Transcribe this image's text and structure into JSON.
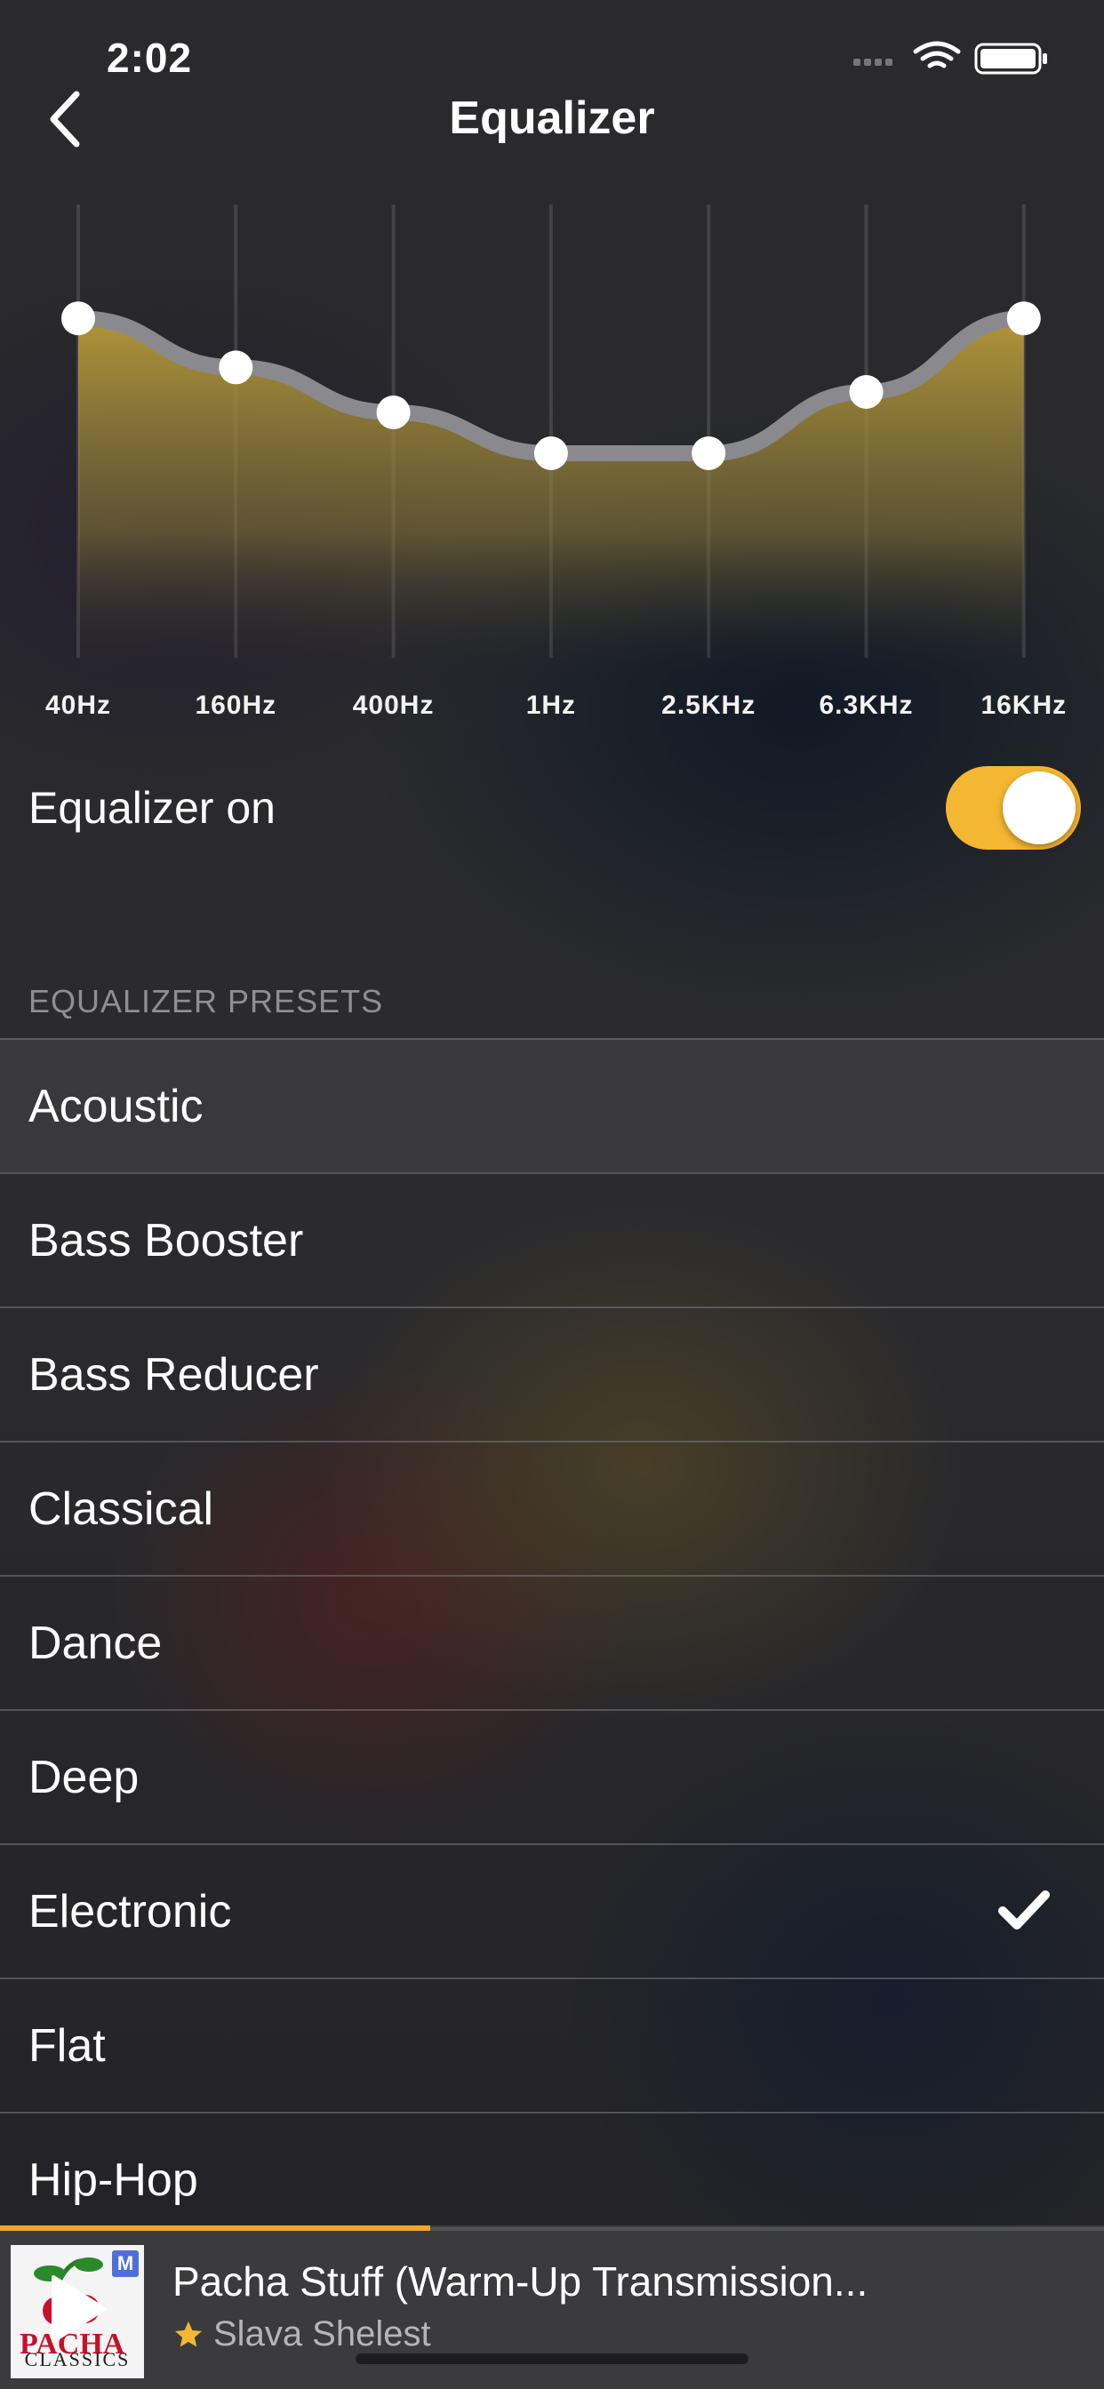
{
  "status_bar": {
    "time": "2:02"
  },
  "nav": {
    "title": "Equalizer",
    "back_icon": "chevron-left-icon"
  },
  "equalizer": {
    "bands": [
      {
        "label": "40Hz",
        "level": 0.83
      },
      {
        "label": "160Hz",
        "level": 0.71
      },
      {
        "label": "400Hz",
        "level": 0.6
      },
      {
        "label": "1Hz",
        "level": 0.5
      },
      {
        "label": "2.5KHz",
        "level": 0.5
      },
      {
        "label": "6.3KHz",
        "level": 0.65
      },
      {
        "label": "16KHz",
        "level": 0.83
      }
    ],
    "fill_color": "#a8913a",
    "curve_color": "#8a8a8e"
  },
  "toggle": {
    "label": "Equalizer on",
    "on": true,
    "color": "#f4b731"
  },
  "presets": {
    "header": "EQUALIZER PRESETS",
    "items": [
      {
        "label": "Acoustic",
        "selected": false
      },
      {
        "label": "Bass Booster",
        "selected": false
      },
      {
        "label": "Bass Reducer",
        "selected": false
      },
      {
        "label": "Classical",
        "selected": false
      },
      {
        "label": "Dance",
        "selected": false
      },
      {
        "label": "Deep",
        "selected": false
      },
      {
        "label": "Electronic",
        "selected": true
      },
      {
        "label": "Flat",
        "selected": false
      },
      {
        "label": "Hip-Hop",
        "selected": false
      }
    ]
  },
  "player": {
    "title": "Pacha Stuff (Warm-Up Transmission...",
    "artist": "Slava Shelest",
    "progress": 0.39,
    "progress_color": "#f4a62a",
    "art_badge": "M",
    "art_text": "CLASSICS"
  }
}
